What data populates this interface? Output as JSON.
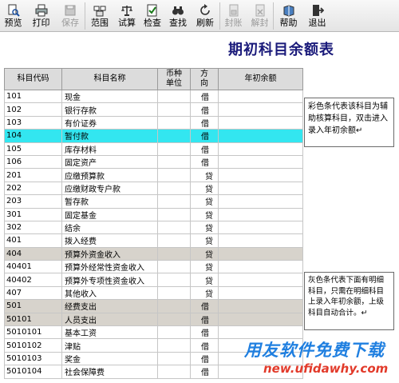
{
  "toolbar": {
    "buttons": [
      {
        "label": "预览",
        "icon": "preview-icon",
        "enabled": true
      },
      {
        "label": "打印",
        "icon": "print-icon",
        "enabled": true
      },
      {
        "label": "保存",
        "icon": "save-icon",
        "enabled": false
      },
      {
        "label": "范围",
        "icon": "range-icon",
        "enabled": true
      },
      {
        "label": "试算",
        "icon": "balance-icon",
        "enabled": true
      },
      {
        "label": "检查",
        "icon": "check-icon",
        "enabled": true
      },
      {
        "label": "查找",
        "icon": "binoculars-icon",
        "enabled": true
      },
      {
        "label": "刷新",
        "icon": "refresh-icon",
        "enabled": true
      },
      {
        "label": "封账",
        "icon": "lock-icon",
        "enabled": false
      },
      {
        "label": "解封",
        "icon": "unlock-icon",
        "enabled": false
      },
      {
        "label": "帮助",
        "icon": "help-icon",
        "enabled": true
      },
      {
        "label": "退出",
        "icon": "exit-icon",
        "enabled": true
      }
    ]
  },
  "title": "期初科目余额表",
  "table": {
    "headers": {
      "code": "科目代码",
      "name": "科目名称",
      "currency_line1": "币种",
      "currency_line2": "单位",
      "direction_line1": "方",
      "direction_line2": "向",
      "balance": "年初余额"
    },
    "rows": [
      {
        "code": "101",
        "name": "现金",
        "direction": "借",
        "highlight": "none"
      },
      {
        "code": "102",
        "name": "银行存款",
        "direction": "借",
        "highlight": "none"
      },
      {
        "code": "103",
        "name": "有价证券",
        "direction": "借",
        "highlight": "none"
      },
      {
        "code": "104",
        "name": "暂付款",
        "direction": "借",
        "highlight": "cyan"
      },
      {
        "code": "105",
        "name": "库存材料",
        "direction": "借",
        "highlight": "none"
      },
      {
        "code": "106",
        "name": "固定资产",
        "direction": "借",
        "highlight": "none"
      },
      {
        "code": "201",
        "name": "应缴预算款",
        "direction": "贷",
        "highlight": "none"
      },
      {
        "code": "202",
        "name": "应缴财政专户款",
        "direction": "贷",
        "highlight": "none"
      },
      {
        "code": "203",
        "name": "暂存款",
        "direction": "贷",
        "highlight": "none"
      },
      {
        "code": "301",
        "name": "固定基金",
        "direction": "贷",
        "highlight": "none"
      },
      {
        "code": "302",
        "name": "结余",
        "direction": "贷",
        "highlight": "none"
      },
      {
        "code": "401",
        "name": "拨入经费",
        "direction": "贷",
        "highlight": "none"
      },
      {
        "code": "404",
        "name": "预算外资金收入",
        "direction": "贷",
        "highlight": "gray"
      },
      {
        "code": "40401",
        "name": "预算外经常性资金收入",
        "direction": "贷",
        "highlight": "none"
      },
      {
        "code": "40402",
        "name": "预算外专项性资金收入",
        "direction": "贷",
        "highlight": "none"
      },
      {
        "code": "407",
        "name": "其他收入",
        "direction": "贷",
        "highlight": "none"
      },
      {
        "code": "501",
        "name": "经费支出",
        "direction": "借",
        "highlight": "gray"
      },
      {
        "code": "50101",
        "name": "人员支出",
        "direction": "借",
        "highlight": "gray"
      },
      {
        "code": "5010101",
        "name": "基本工资",
        "direction": "借",
        "highlight": "none"
      },
      {
        "code": "5010102",
        "name": "津贴",
        "direction": "借",
        "highlight": "none"
      },
      {
        "code": "5010103",
        "name": "奖金",
        "direction": "借",
        "highlight": "none"
      },
      {
        "code": "5010104",
        "name": "社会保障费",
        "direction": "借",
        "highlight": "none"
      }
    ]
  },
  "notes": {
    "cyan_note": "彩色条代表该科目为辅助核算科目，双击进入录入年初余额↵",
    "gray_note": "灰色条代表下面有明细科目，只需在明细科目上录入年初余额，上级科目自动合计。↵"
  },
  "watermark": {
    "line1": "用友软件免费下载",
    "line2": "new.ufidawhy.com"
  },
  "colors": {
    "cyan_row": "#33e6f0",
    "gray_row": "#d7d3cc",
    "title": "#1a1a7a",
    "watermark_blue": "#1f7fe0",
    "watermark_red": "#e23a2a"
  }
}
